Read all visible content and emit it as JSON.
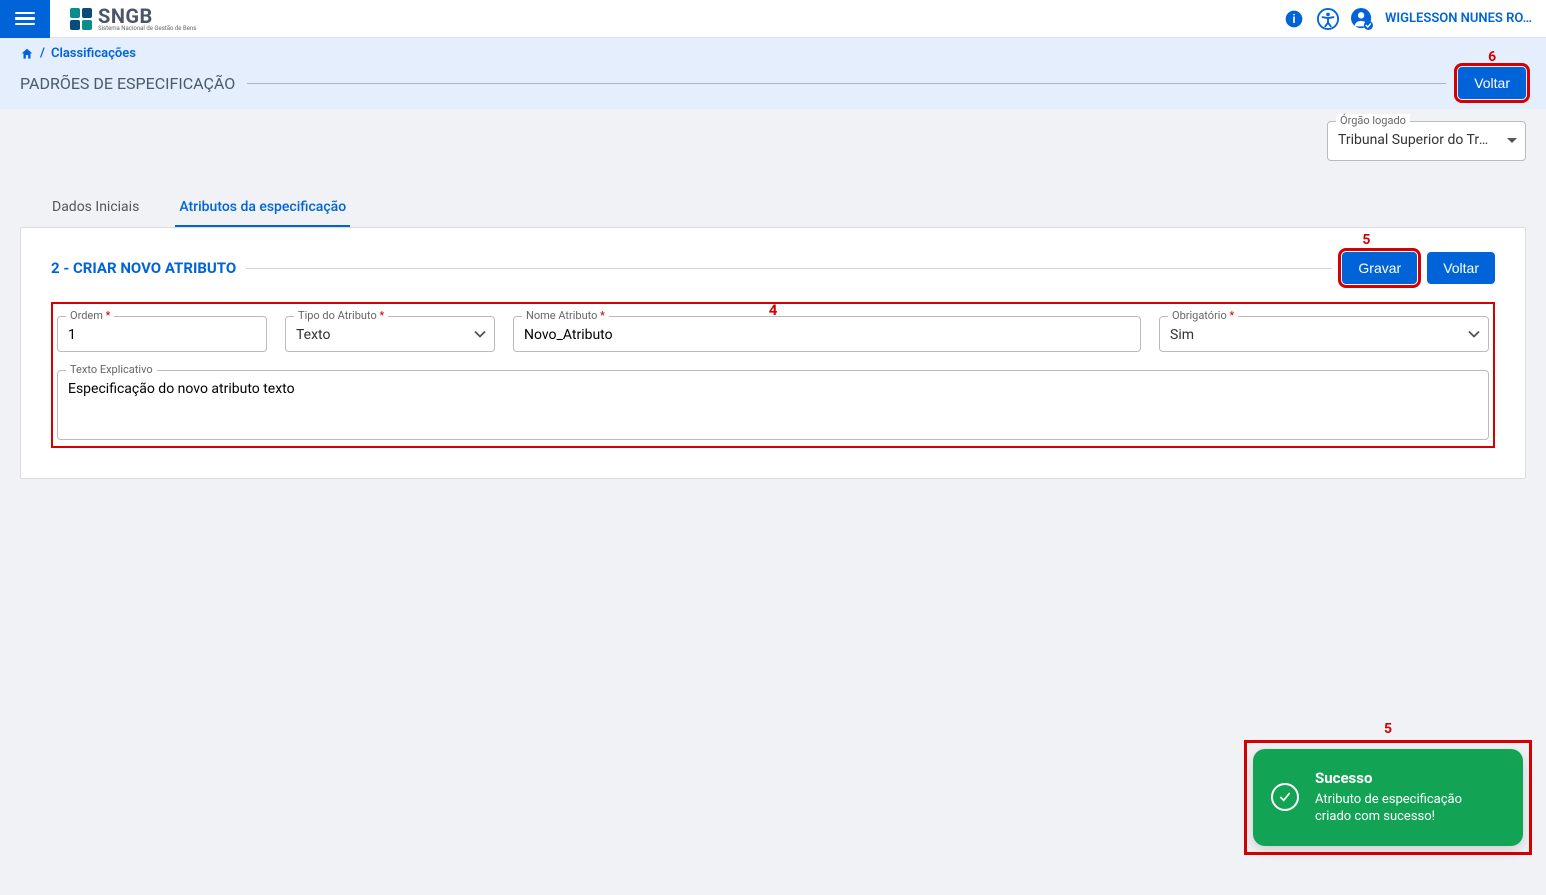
{
  "header": {
    "logo_main": "SNGB",
    "logo_sub": "Sistema Nacional de Gestão de Bens",
    "user_name": "WIGLESSON NUNES RO…"
  },
  "breadcrumb": {
    "link": "Classificações",
    "page_title": "PADRÕES DE ESPECIFICAÇÃO",
    "voltar_label": "Voltar"
  },
  "orgao": {
    "label": "Órgão logado",
    "value": "Tribunal Superior do Tra…"
  },
  "tabs": {
    "t1": "Dados Iniciais",
    "t2": "Atributos da especificação"
  },
  "section": {
    "title": "2 - CRIAR NOVO ATRIBUTO",
    "gravar_label": "Gravar",
    "voltar_label": "Voltar"
  },
  "form": {
    "ordem_label": "Ordem",
    "ordem_value": "1",
    "tipo_label": "Tipo do Atributo",
    "tipo_value": "Texto",
    "nome_label": "Nome Atributo",
    "nome_value": "Novo_Atributo",
    "obrig_label": "Obrigatório",
    "obrig_value": "Sim",
    "texto_label": "Texto Explicativo",
    "texto_value": "Especificação do novo atributo texto"
  },
  "toast": {
    "title": "Sucesso",
    "message": "Atributo de especificação criado com sucesso!"
  },
  "annotations": {
    "a4": "4",
    "a5": "5",
    "a5b": "5",
    "a6": "6"
  }
}
